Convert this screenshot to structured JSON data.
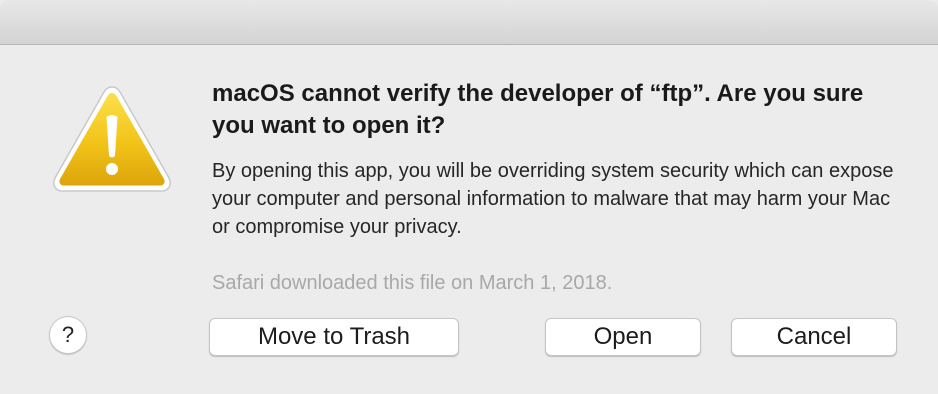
{
  "dialog": {
    "title": "macOS cannot verify the developer of “ftp”. Are you sure you want to open it?",
    "message": "By opening this app, you will be overriding system security which can expose your computer and personal information to malware that may harm your Mac or compromise your privacy.",
    "download_info": "Safari downloaded this file on March 1, 2018.",
    "icon": "warning-triangle-icon",
    "icon_color": "#f2c318",
    "help_label": "?",
    "buttons": {
      "move_to_trash": "Move to Trash",
      "open": "Open",
      "cancel": "Cancel"
    }
  }
}
